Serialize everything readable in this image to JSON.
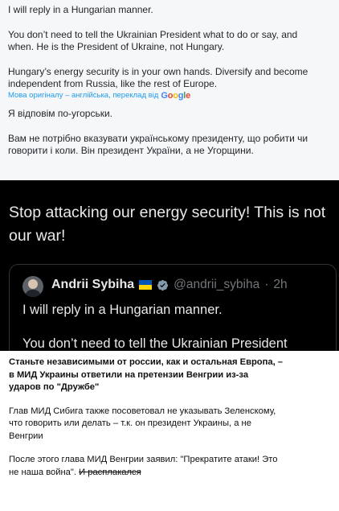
{
  "tweet_en": {
    "line1": "I will reply in a Hungarian manner.",
    "para2_a": "You don’t need to tell the Ukrainian President what to do or say, and",
    "para2_b": "when. He is the President of Ukraine, not Hungary.",
    "para3_a": "Hungary’s energy security is in your own hands. Diversify and become",
    "para3_b": "independent from Russia, like the rest of Europe."
  },
  "translation": {
    "label": "Мова оригіналу – англійська, переклад від",
    "provider": "Google"
  },
  "tweet_uk": {
    "line1": "Я відповім по-угорськи.",
    "para2_a": "Вам не потрібно вказувати українському президенту, що робити чи",
    "para2_b": "говорити і коли. Він президент України, а не Угорщини."
  },
  "dark_post": {
    "line1": "Stop attacking our energy security! This is not",
    "line2": "our war!"
  },
  "quoted_post": {
    "name": "Andrii Sybiha",
    "handle": "@andrii_sybiha",
    "separator": "·",
    "time": "2h",
    "line1": "I will reply in a Hungarian manner.",
    "line2": "You don’t need to tell the Ukrainian President"
  },
  "caption": {
    "p1_a": "Станьте независимыми от россии, как и остальная Европа, –",
    "p1_b": "в МИД Украины ответили на претензии Венгрии из-за",
    "p1_c": "ударов по \"Дружбе\"",
    "p2_a": "Глав МИД Сибига также посоветовал не указывать Зеленскому,",
    "p2_b": "что говорить или делать – т.к. он президент Украины, а не",
    "p2_c": "Венгрии",
    "p3_a": "После этого глава МИД Венгрии заявил: \"Прекратите атаки! Это",
    "p3_b": "не наша война\".",
    "p3_strike": "И расплакался"
  },
  "colors": {
    "dark_bg": "#000000",
    "light_bg": "#f6f7f9",
    "twitter_blue": "#1d9bf0",
    "ua_blue": "#0057b7",
    "ua_yellow": "#ffd700"
  },
  "icons": [
    "google-logo",
    "ukraine-flag-icon",
    "verified-badge-icon",
    "avatar"
  ]
}
